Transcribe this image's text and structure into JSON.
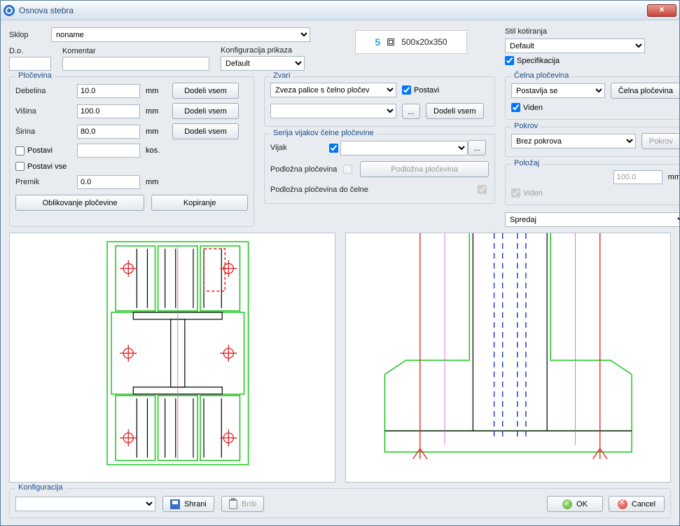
{
  "window": {
    "title": "Osnova stebra"
  },
  "top": {
    "sklop_label": "Sklop",
    "sklop_value": "noname",
    "do_label": "D.o.",
    "do_value": "",
    "komentar_label": "Komentar",
    "komentar_value": "",
    "konfig_label": "Konfiguracija prikaza",
    "konfig_value": "Default"
  },
  "preview": {
    "count": "5",
    "dims": "500x20x350"
  },
  "stil": {
    "title": "Stil kotiranja",
    "value": "Default",
    "spec_label": "Specifikacija",
    "spec_checked": true
  },
  "plocevina": {
    "title": "Pločevina",
    "debelina_label": "Debelina",
    "debelina_value": "10.0",
    "visina_label": "Višina",
    "visina_value": "100.0",
    "sirina_label": "Širina",
    "sirina_value": "80.0",
    "mm": "mm",
    "dodeli": "Dodeli vsem",
    "postavi_label": "Postavi",
    "kos_label": "kos.",
    "postavi_vse_label": "Postavi vse",
    "premik_label": "Premik",
    "premik_value": "0.0",
    "oblikovanje": "Oblikovanje pločevine",
    "kopiranje": "Kopiranje"
  },
  "zvari": {
    "title": "Zvari",
    "sel1": "Zveza palice s čelno pločev",
    "postavi_label": "Postavi",
    "postavi_checked": true,
    "sel2": "",
    "browse": "...",
    "dodeli": "Dodeli vsem"
  },
  "serija": {
    "title": "Serija vijakov čelne pločevine",
    "vijak_label": "Vijak",
    "vijak_checked": true,
    "vijak_value": "",
    "browse": "...",
    "podlozna_label": "Podložna pločevina",
    "podlozna_btn": "Podložna pločevina",
    "podlozna_do_label": "Podložna pločevina do čelne"
  },
  "celna": {
    "title": "Čelna pločevina",
    "sel": "Postavlja se",
    "btn": "Čelna pločevina",
    "viden_label": "Viden",
    "viden_checked": true
  },
  "pokrov": {
    "title": "Pokrov",
    "sel": "Brez pokrova",
    "btn": "Pokrov"
  },
  "polozaj": {
    "title": "Položaj",
    "value": "100.0",
    "mm": "mm",
    "viden_label": "Viden"
  },
  "spredaj": {
    "value": "Spredaj"
  },
  "footer": {
    "title": "Konfiguracija",
    "shrani": "Shrani",
    "brisi": "Briši",
    "ok": "OK",
    "cancel": "Cancel"
  }
}
